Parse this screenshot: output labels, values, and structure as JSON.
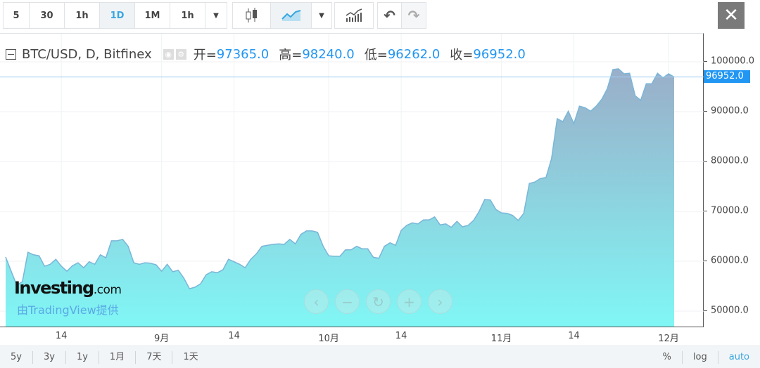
{
  "toolbar": {
    "intervals": [
      "5",
      "30",
      "1h",
      "1D",
      "1M",
      "1h"
    ],
    "active_interval": "1D",
    "chart_type_icons": [
      "candlestick-icon",
      "area-chart-icon"
    ],
    "indicators_icon": "indicators-icon",
    "undo_icon": "undo-icon",
    "redo_icon": "redo-icon",
    "close_label": "✕"
  },
  "legend": {
    "symbol": "BTC/USD, D, Bitfinex",
    "open_label": "开=",
    "open": "97365.0",
    "high_label": "高=",
    "high": "98240.0",
    "low_label": "低=",
    "low": "96262.0",
    "close_label": "收=",
    "close": "96952.0"
  },
  "price_label": "96952.0",
  "watermark": {
    "brand": "Investing",
    "brand_suffix": ".com",
    "provider": "由TradingView提供"
  },
  "nav_buttons": [
    "‹",
    "−",
    "↻",
    "+",
    "›"
  ],
  "bottom": {
    "ranges": [
      "5y",
      "3y",
      "1y",
      "1月",
      "7天",
      "1天"
    ],
    "options": [
      "%",
      "log",
      "auto"
    ],
    "active_option": "auto"
  },
  "colors": {
    "accent": "#2196f3",
    "area_top": "#9aaec9",
    "area_bottom": "#80f7f5",
    "line": "#7ab6d8"
  },
  "chart_data": {
    "type": "area",
    "ylim": [
      45000,
      103000
    ],
    "y_ticks": [
      50000,
      60000,
      70000,
      80000,
      90000,
      100000
    ],
    "y_tick_labels": [
      "50000.0",
      "60000.0",
      "70000.0",
      "80000.0",
      "90000.0",
      "100000.0"
    ],
    "x_ticks": [
      {
        "label": "14",
        "date": "08-14"
      },
      {
        "label": "9月",
        "date": "09-01"
      },
      {
        "label": "14",
        "date": "09-14"
      },
      {
        "label": "10月",
        "date": "10-01"
      },
      {
        "label": "14",
        "date": "10-14"
      },
      {
        "label": "11月",
        "date": "11-01"
      },
      {
        "label": "14",
        "date": "11-14"
      },
      {
        "label": "12月",
        "date": "12-01"
      }
    ],
    "x": [
      "08-04",
      "08-05",
      "08-06",
      "08-07",
      "08-08",
      "08-09",
      "08-10",
      "08-11",
      "08-12",
      "08-13",
      "08-14",
      "08-15",
      "08-16",
      "08-17",
      "08-18",
      "08-19",
      "08-20",
      "08-21",
      "08-22",
      "08-23",
      "08-24",
      "08-25",
      "08-26",
      "08-27",
      "08-28",
      "08-29",
      "08-30",
      "08-31",
      "09-01",
      "09-02",
      "09-03",
      "09-04",
      "09-05",
      "09-06",
      "09-07",
      "09-08",
      "09-09",
      "09-10",
      "09-11",
      "09-12",
      "09-13",
      "09-14",
      "09-15",
      "09-16",
      "09-17",
      "09-18",
      "09-19",
      "09-20",
      "09-21",
      "09-22",
      "09-23",
      "09-24",
      "09-25",
      "09-26",
      "09-27",
      "09-28",
      "09-29",
      "09-30",
      "10-01",
      "10-02",
      "10-03",
      "10-04",
      "10-05",
      "10-06",
      "10-07",
      "10-08",
      "10-09",
      "10-10",
      "10-11",
      "10-12",
      "10-13",
      "10-14",
      "10-15",
      "10-16",
      "10-17",
      "10-18",
      "10-19",
      "10-20",
      "10-21",
      "10-22",
      "10-23",
      "10-24",
      "10-25",
      "10-26",
      "10-27",
      "10-28",
      "10-29",
      "10-30",
      "10-31",
      "11-01",
      "11-02",
      "11-03",
      "11-04",
      "11-05",
      "11-06",
      "11-07",
      "11-08",
      "11-09",
      "11-10",
      "11-11",
      "11-12",
      "11-13",
      "11-14",
      "11-15",
      "11-16",
      "11-17",
      "11-18",
      "11-19",
      "11-20",
      "11-21",
      "11-22",
      "11-23",
      "11-24",
      "11-25",
      "11-26",
      "11-27",
      "11-28",
      "11-29",
      "11-30",
      "12-01",
      "12-02"
    ],
    "values": [
      60850,
      58000,
      55200,
      55900,
      61800,
      61300,
      61100,
      59000,
      59400,
      60400,
      59000,
      58000,
      59100,
      59700,
      58700,
      59900,
      59400,
      61300,
      60700,
      64100,
      64100,
      64400,
      63000,
      59700,
      59400,
      59700,
      59600,
      59300,
      58000,
      59400,
      57900,
      58200,
      56600,
      54500,
      54800,
      55500,
      57300,
      57900,
      57700,
      58300,
      60400,
      59900,
      59400,
      58700,
      60400,
      61500,
      63000,
      63200,
      63400,
      63500,
      63400,
      64400,
      63500,
      65400,
      66100,
      66100,
      65800,
      63000,
      61100,
      61000,
      61000,
      62300,
      62300,
      63000,
      62500,
      62500,
      60800,
      60600,
      63000,
      63700,
      63200,
      66200,
      67200,
      67700,
      67500,
      68300,
      68300,
      68900,
      67300,
      67500,
      66800,
      68000,
      66900,
      67200,
      68200,
      70000,
      72400,
      72300,
      70400,
      69700,
      69600,
      69200,
      68200,
      69600,
      75600,
      75900,
      76600,
      76800,
      80600,
      88600,
      88000,
      90100,
      87600,
      91100,
      90800,
      90100,
      91100,
      92500,
      94600,
      98450,
      98600,
      97600,
      97700,
      93200,
      92300,
      95600,
      95600,
      97700,
      96800,
      97600,
      96952
    ]
  }
}
